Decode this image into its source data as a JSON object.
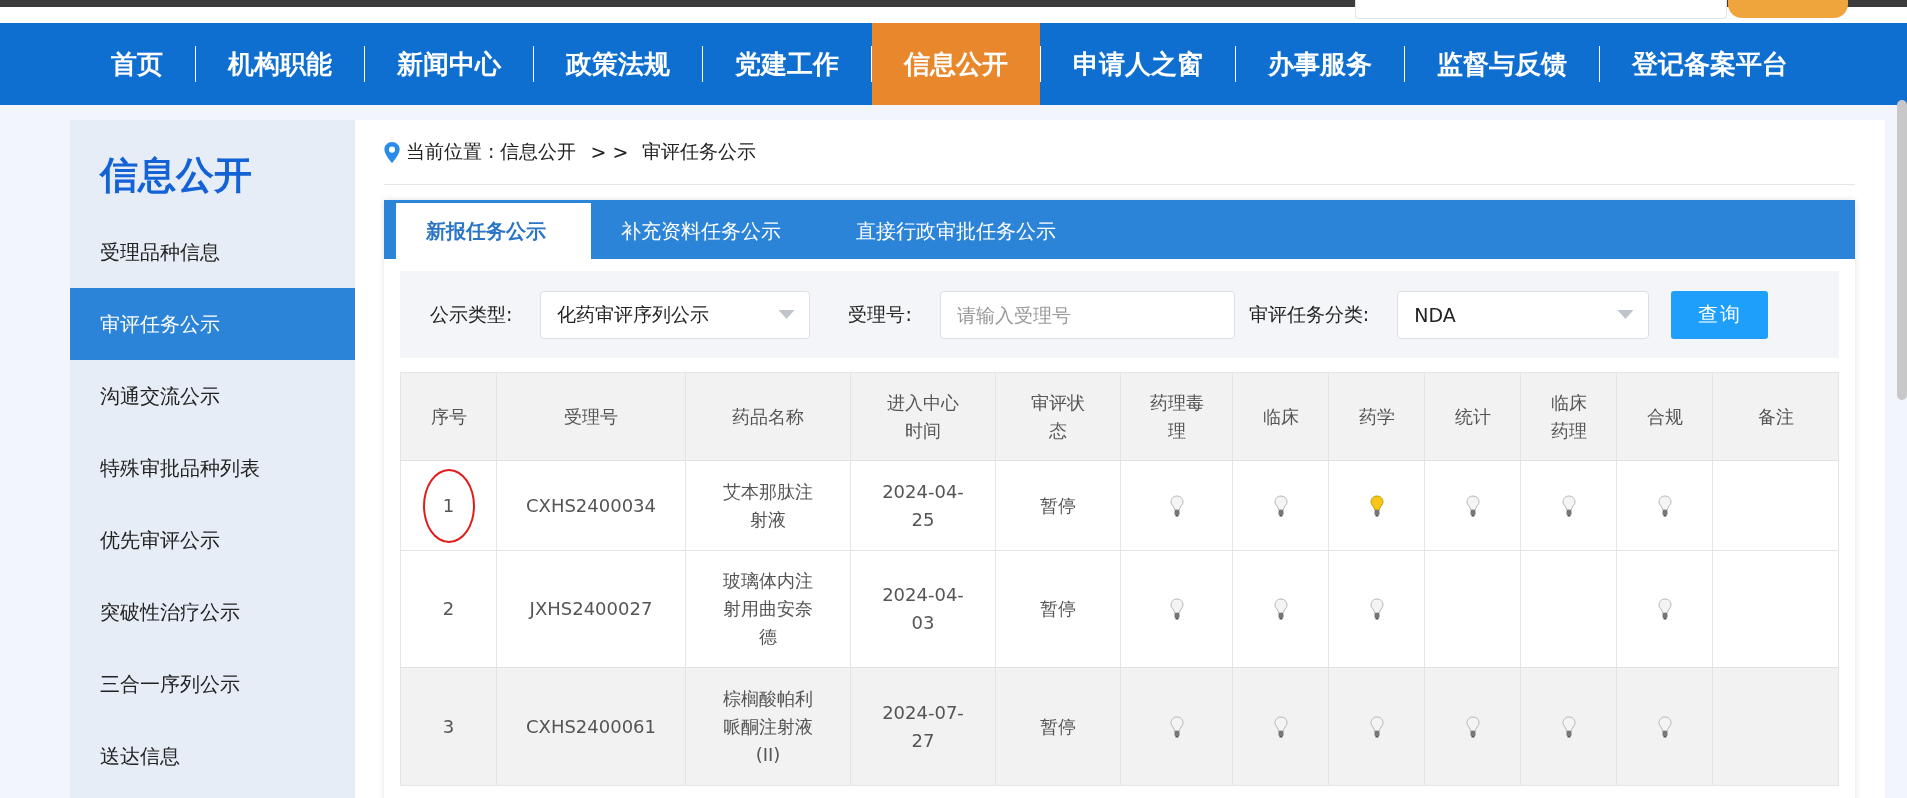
{
  "top_bar": {
    "search": {
      "kind": "field"
    },
    "button": {
      "kind": "button"
    }
  },
  "nav": [
    {
      "label": "首页",
      "selected": false
    },
    {
      "label": "机构职能",
      "selected": false
    },
    {
      "label": "新闻中心",
      "selected": false
    },
    {
      "label": "政策法规",
      "selected": false
    },
    {
      "label": "党建工作",
      "selected": false
    },
    {
      "label": "信息公开",
      "selected": true
    },
    {
      "label": "申请人之窗",
      "selected": false
    },
    {
      "label": "办事服务",
      "selected": false
    },
    {
      "label": "监督与反馈",
      "selected": false
    },
    {
      "label": "登记备案平台",
      "selected": false
    }
  ],
  "sidebar": {
    "title": "信息公开",
    "items": [
      {
        "label": "受理品种信息",
        "selected": false
      },
      {
        "label": "审评任务公示",
        "selected": true
      },
      {
        "label": "沟通交流公示",
        "selected": false
      },
      {
        "label": "特殊审批品种列表",
        "selected": false
      },
      {
        "label": "优先审评公示",
        "selected": false
      },
      {
        "label": "突破性治疗公示",
        "selected": false
      },
      {
        "label": "三合一序列公示",
        "selected": false
      },
      {
        "label": "送达信息",
        "selected": false
      }
    ]
  },
  "breadcrumb": {
    "prefix": "当前位置 : 信息公开",
    "separator": "> >",
    "current": "审评任务公示"
  },
  "tabs": [
    {
      "label": "新报任务公示",
      "selected": true
    },
    {
      "label": "补充资料任务公示",
      "selected": false
    },
    {
      "label": "直接行政审批任务公示",
      "selected": false
    }
  ],
  "filters": [
    {
      "kind": "select",
      "label": "公示类型:",
      "value": "化药审评序列公示"
    },
    {
      "kind": "input",
      "label": "受理号:",
      "placeholder": "请输入受理号"
    },
    {
      "kind": "select",
      "label": "审评任务分类:",
      "value": "NDA"
    }
  ],
  "query_button": "查询",
  "table": {
    "columns": [
      "序号",
      "受理号",
      "药品名称",
      "进入中心时间",
      "审评状态",
      "药理毒理",
      "临床",
      "药学",
      "统计",
      "临床药理",
      "合规",
      "备注"
    ],
    "rows": [
      {
        "cells": [
          "1",
          "CXHS2400034",
          "艾本那肽注射液",
          "2024-04-25",
          "暂停"
        ],
        "lamps": [
          {
            "kind": "bulb",
            "lit": false
          },
          {
            "kind": "bulb",
            "lit": false
          },
          {
            "kind": "bulb",
            "lit": true
          },
          {
            "kind": "bulb",
            "lit": false
          },
          {
            "kind": "bulb",
            "lit": false
          },
          {
            "kind": "bulb",
            "lit": false
          }
        ],
        "shaded": false,
        "circled": true
      },
      {
        "cells": [
          "2",
          "JXHS2400027",
          "玻璃体内注射用曲安奈德",
          "2024-04-03",
          "暂停"
        ],
        "lamps": [
          {
            "kind": "bulb",
            "lit": false
          },
          {
            "kind": "bulb",
            "lit": false
          },
          {
            "kind": "bulb",
            "lit": false
          },
          {
            "kind": "empty"
          },
          {
            "kind": "empty"
          },
          {
            "kind": "bulb",
            "lit": false
          }
        ],
        "shaded": false,
        "circled": false
      },
      {
        "cells": [
          "3",
          "CXHS2400061",
          "棕榈酸帕利哌酮注射液(II)",
          "2024-07-27",
          "暂停"
        ],
        "lamps": [
          {
            "kind": "bulb",
            "lit": false
          },
          {
            "kind": "bulb",
            "lit": false
          },
          {
            "kind": "bulb",
            "lit": false
          },
          {
            "kind": "bulb",
            "lit": false
          },
          {
            "kind": "bulb",
            "lit": false
          },
          {
            "kind": "bulb",
            "lit": false
          }
        ],
        "shaded": true,
        "circled": false
      }
    ]
  }
}
